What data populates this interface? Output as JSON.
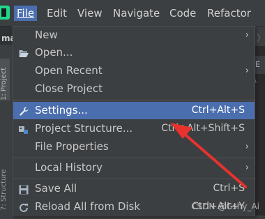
{
  "menubar": {
    "items": [
      {
        "label": "File",
        "active": true
      },
      {
        "label": "Edit"
      },
      {
        "label": "View"
      },
      {
        "label": "Navigate"
      },
      {
        "label": "Code"
      },
      {
        "label": "Refactor"
      }
    ]
  },
  "background": {
    "project_name_cut": "ma",
    "left_tabs": [
      "1: Project",
      "7: Structure"
    ],
    "right_tab_cut": "E",
    "right_path_cut": "\\"
  },
  "file_menu": {
    "items": [
      {
        "label": "New",
        "icon": null,
        "shortcut": "",
        "submenu": true
      },
      {
        "label": "Open...",
        "icon": "folder-open-icon",
        "shortcut": "",
        "submenu": false
      },
      {
        "label": "Open Recent",
        "icon": null,
        "shortcut": "",
        "submenu": true
      },
      {
        "label": "Close Project",
        "icon": null,
        "shortcut": "",
        "submenu": false
      },
      {
        "label": "Settings...",
        "icon": "wrench-icon",
        "shortcut": "Ctrl+Alt+S",
        "submenu": false,
        "selected": true
      },
      {
        "label": "Project Structure...",
        "icon": "project-structure-icon",
        "shortcut": "Ctrl+Alt+Shift+S",
        "submenu": false
      },
      {
        "label": "File Properties",
        "icon": null,
        "shortcut": "",
        "submenu": true
      },
      {
        "label": "Local History",
        "icon": null,
        "shortcut": "",
        "submenu": true
      },
      {
        "label": "Save All",
        "icon": "save-icon",
        "shortcut": "Ctrl+S",
        "submenu": false
      },
      {
        "label": "Reload All from Disk",
        "icon": "reload-icon",
        "shortcut": "Ctrl+Alt+Y",
        "submenu": false
      }
    ]
  },
  "watermark": "CSDN @Gshy_Ai",
  "colors": {
    "selection": "#4b6eaf",
    "menu_bg": "#3c3f41",
    "annotation_arrow": "#e8322d"
  }
}
